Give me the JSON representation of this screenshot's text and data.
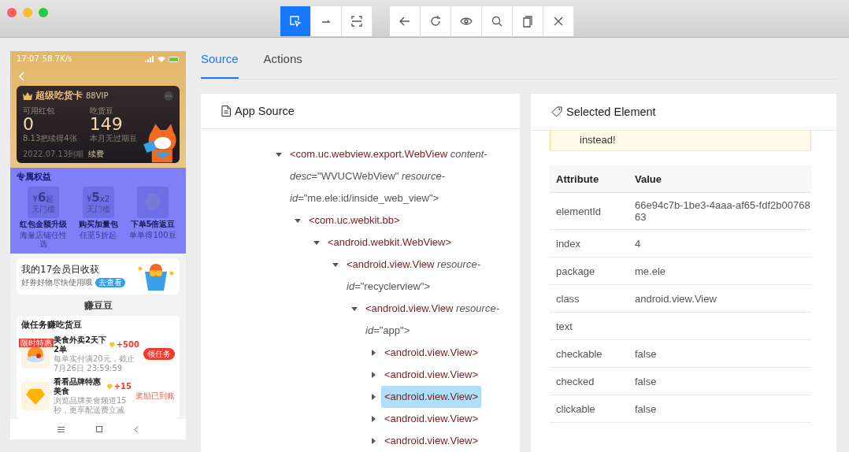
{
  "toolbar": {
    "groups": [
      [
        {
          "kind": "select",
          "selected": true
        },
        {
          "kind": "swipe",
          "selected": false
        },
        {
          "kind": "tap-area",
          "selected": false
        }
      ],
      [
        {
          "kind": "back"
        },
        {
          "kind": "refresh"
        },
        {
          "kind": "eye"
        },
        {
          "kind": "search"
        },
        {
          "kind": "copy"
        },
        {
          "kind": "close"
        }
      ]
    ]
  },
  "phone": {
    "status": {
      "time": "17:07",
      "speed": "58.7K/s"
    },
    "vip_card": {
      "title": "超级吃货卡",
      "badge": "88VIP",
      "stats": [
        {
          "label": "可用红包",
          "value": "0",
          "note": "8.13把续得4张"
        },
        {
          "label": "吃货豆",
          "value": "149",
          "note": "本月无过期豆"
        }
      ],
      "expiry": "2022.07.13到期",
      "renew": "续费"
    },
    "benefits": {
      "title": "专属权益",
      "highlighted": true,
      "items": [
        {
          "kind": "coupon",
          "currency": "¥",
          "amount": "6",
          "suffix": "起",
          "tag": "无门槛",
          "name": "红包金额升级",
          "desc": "海量店铺任性选"
        },
        {
          "kind": "coupon",
          "currency": "¥",
          "amount": "5",
          "suffix": "x2",
          "tag": "无门槛",
          "name": "购买加量包",
          "desc": "任至5折起"
        },
        {
          "kind": "bean",
          "name": "下单5倍返豆",
          "desc": "单单得100豆"
        }
      ]
    },
    "banner": {
      "title": "我的17会员日收获",
      "subtitle": "好券好物尽快使用哦",
      "button": "去查看"
    },
    "section_title": "赚豆豆",
    "tasks": {
      "title": "做任务赚吃货豆",
      "items": [
        {
          "kind": "button",
          "badge": "限时特惠",
          "name": "美食外卖2天下2单",
          "reward": "+500",
          "desc": "每单实付满20元，截止7月26日 23:59:59",
          "action": "领任务"
        },
        {
          "kind": "done",
          "name": "看看品牌特惠美食",
          "reward": "+15",
          "desc": "浏览品牌美食频道15秒，更享配送费立减",
          "action": "奖励已到账"
        }
      ]
    }
  },
  "tabs": [
    {
      "label": "Source",
      "selected": true
    },
    {
      "label": "Actions",
      "selected": false
    }
  ],
  "source": {
    "title": "App Source",
    "tree": [
      {
        "tag": "<com.uc.webview.export.WebView",
        "attrs": " *content-desc*=\"WVUCWebView\" *resource-id*=\"me.ele:id/inside_web_view\">",
        "expanded": true,
        "selected": false,
        "children": [
          {
            "tag": "<com.uc.webkit.bb>",
            "expanded": true,
            "selected": false,
            "children": [
              {
                "tag": "<android.webkit.WebView>",
                "expanded": true,
                "selected": false,
                "children": [
                  {
                    "tag": "<android.view.View",
                    "attrs": " *resource-id*=\"recyclerview\">",
                    "expanded": true,
                    "selected": false,
                    "children": [
                      {
                        "tag": "<android.view.View",
                        "attrs": " *resource-id*=\"app\">",
                        "expanded": true,
                        "selected": false,
                        "children": [
                          {
                            "tag": "<android.view.View>",
                            "expanded": false,
                            "selected": false
                          },
                          {
                            "tag": "<android.view.View>",
                            "expanded": false,
                            "selected": false
                          },
                          {
                            "tag": "<android.view.View>",
                            "expanded": false,
                            "selected": true
                          },
                          {
                            "tag": "<android.view.View>",
                            "expanded": false,
                            "selected": false
                          },
                          {
                            "tag": "<android.view.View>",
                            "expanded": false,
                            "selected": false
                          }
                        ]
                      }
                    ]
                  }
                ]
              }
            ]
          }
        ]
      }
    ]
  },
  "selected_element": {
    "title": "Selected Element",
    "note": "instead!",
    "columns": [
      "Attribute",
      "Value"
    ],
    "rows": [
      [
        "elementId",
        "66e94c7b-1be3-4aaa-af65-fdf2b0076863"
      ],
      [
        "index",
        "4"
      ],
      [
        "package",
        "me.ele"
      ],
      [
        "class",
        "android.view.View"
      ],
      [
        "text",
        ""
      ],
      [
        "checkable",
        "false"
      ],
      [
        "checked",
        "false"
      ],
      [
        "clickable",
        "false"
      ]
    ]
  }
}
